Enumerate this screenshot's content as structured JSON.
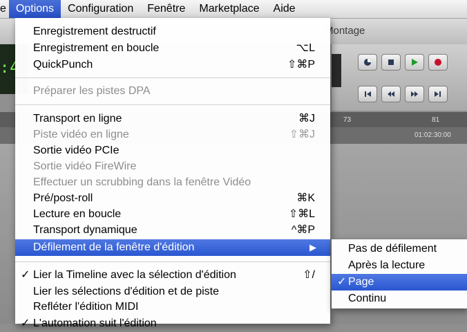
{
  "menubar": {
    "cut_label": "e",
    "items": [
      "Options",
      "Configuration",
      "Fenêtre",
      "Marketplace",
      "Aide"
    ]
  },
  "background": {
    "window_title": "Montage",
    "counter": ":4",
    "ruler_a": "73",
    "ruler_b": "81",
    "ruler_time": "01:02:30:00"
  },
  "options_menu": {
    "items": [
      {
        "label": "Enregistrement destructif",
        "shortcut": ""
      },
      {
        "label": "Enregistrement en boucle",
        "shortcut": "⌥L"
      },
      {
        "label": "QuickPunch",
        "shortcut": "⇧⌘P"
      },
      {
        "label": "Préparer les pistes DPA",
        "shortcut": ""
      },
      {
        "label": "Transport en ligne",
        "shortcut": "⌘J"
      },
      {
        "label": "Piste vidéo en ligne",
        "shortcut": "⇧⌘J"
      },
      {
        "label": "Sortie vidéo PCIe",
        "shortcut": ""
      },
      {
        "label": "Sortie vidéo FireWire",
        "shortcut": ""
      },
      {
        "label": "Effectuer un scrubbing dans la fenêtre Vidéo",
        "shortcut": ""
      },
      {
        "label": "Pré/post-roll",
        "shortcut": "⌘K"
      },
      {
        "label": "Lecture en boucle",
        "shortcut": "⇧⌘L"
      },
      {
        "label": "Transport dynamique",
        "shortcut": "^⌘P"
      },
      {
        "label": "Défilement de la fenêtre d'édition",
        "shortcut": "▶"
      },
      {
        "label": "Lier la Timeline avec la sélection d'édition",
        "shortcut": "⇧/"
      },
      {
        "label": "Lier les sélections d'édition et de piste",
        "shortcut": ""
      },
      {
        "label": "Refléter l'édition MIDI",
        "shortcut": ""
      },
      {
        "label": "L'automation suit l'édition",
        "shortcut": ""
      }
    ]
  },
  "submenu": {
    "items": [
      "Pas de défilement",
      "Après la lecture",
      "Page",
      "Continu"
    ]
  },
  "check_mark": "✓"
}
